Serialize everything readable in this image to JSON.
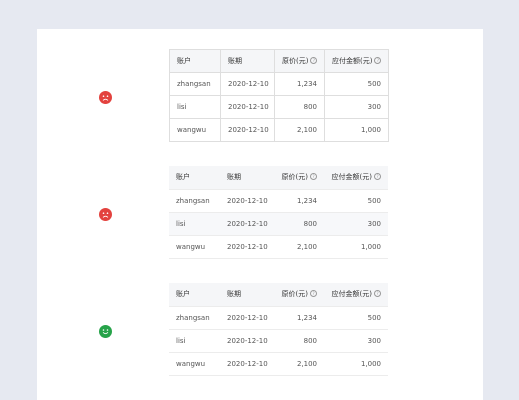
{
  "colors": {
    "error": "#e3423e",
    "success": "#27a34a",
    "panel": "#ffffff",
    "background": "#e6e9f1"
  },
  "tables": [
    {
      "status_icon": "sad-face-icon",
      "headers": {
        "account": "账户",
        "period": "账期",
        "price": "原价(元)",
        "payable": "应付金额(元)",
        "help_mark": "?"
      },
      "rows": [
        {
          "account": "zhangsan",
          "period": "2020-12-10",
          "price": "1,234",
          "payable": "500"
        },
        {
          "account": "lisi",
          "period": "2020-12-10",
          "price": "800",
          "payable": "300"
        },
        {
          "account": "wangwu",
          "period": "2020-12-10",
          "price": "2,100",
          "payable": "1,000"
        }
      ]
    },
    {
      "status_icon": "sad-face-icon",
      "headers": {
        "account": "账户",
        "period": "账期",
        "price": "原价(元)",
        "payable": "应付金额(元)",
        "help_mark": "?"
      },
      "rows": [
        {
          "account": "zhangsan",
          "period": "2020-12-10",
          "price": "1,234",
          "payable": "500"
        },
        {
          "account": "lisi",
          "period": "2020-12-10",
          "price": "800",
          "payable": "300"
        },
        {
          "account": "wangwu",
          "period": "2020-12-10",
          "price": "2,100",
          "payable": "1,000"
        }
      ]
    },
    {
      "status_icon": "happy-face-icon",
      "headers": {
        "account": "账户",
        "period": "账期",
        "price": "原价(元)",
        "payable": "应付金额(元)",
        "help_mark": "?"
      },
      "rows": [
        {
          "account": "zhangsan",
          "period": "2020-12-10",
          "price": "1,234",
          "payable": "500"
        },
        {
          "account": "lisi",
          "period": "2020-12-10",
          "price": "800",
          "payable": "300"
        },
        {
          "account": "wangwu",
          "period": "2020-12-10",
          "price": "2,100",
          "payable": "1,000"
        }
      ]
    }
  ]
}
